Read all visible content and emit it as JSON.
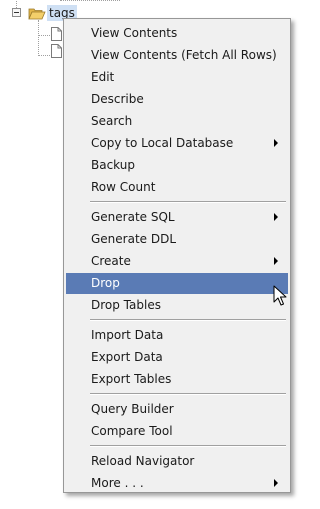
{
  "tree": {
    "node_label": "tags",
    "expander_icon": "minus-box-icon",
    "folder_icon": "open-folder-icon",
    "child_icon": "file-icon"
  },
  "menu": {
    "items": [
      {
        "label": "View Contents"
      },
      {
        "label": "View Contents (Fetch All Rows)"
      },
      {
        "label": "Edit"
      },
      {
        "label": "Describe"
      },
      {
        "label": "Search"
      },
      {
        "label": "Copy to Local Database",
        "submenu": true
      },
      {
        "label": "Backup"
      },
      {
        "label": "Row Count"
      },
      {
        "label": "Generate SQL",
        "submenu": true
      },
      {
        "label": "Generate DDL"
      },
      {
        "label": "Create",
        "submenu": true
      },
      {
        "label": "Drop",
        "highlighted": true
      },
      {
        "label": "Drop Tables"
      },
      {
        "label": "Import Data"
      },
      {
        "label": "Export Data"
      },
      {
        "label": "Export Tables"
      },
      {
        "label": "Query Builder"
      },
      {
        "label": "Compare Tool"
      },
      {
        "label": "Reload Navigator"
      },
      {
        "label": "More . . .",
        "submenu": true
      }
    ],
    "highlight_color": "#5a7bb5",
    "background_color": "#f0f0f0"
  }
}
